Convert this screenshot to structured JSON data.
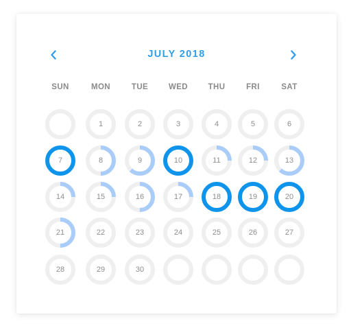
{
  "calendar": {
    "month_title": "JULY 2018",
    "prev_icon": "chevron-left-icon",
    "next_icon": "chevron-right-icon",
    "weekdays": [
      "SUN",
      "MON",
      "TUE",
      "WED",
      "THU",
      "FRI",
      "SAT"
    ],
    "colors": {
      "accent": "#2f9fe6",
      "ring_full": "#0f94ec",
      "ring_partial": "#a9cdf8",
      "ring_track": "#efefef",
      "day_text": "#8d8d8d"
    },
    "weeks": [
      [
        {
          "day": "",
          "fill": 0
        },
        {
          "day": "1",
          "fill": 0
        },
        {
          "day": "2",
          "fill": 0
        },
        {
          "day": "3",
          "fill": 0
        },
        {
          "day": "4",
          "fill": 0
        },
        {
          "day": "5",
          "fill": 0
        },
        {
          "day": "6",
          "fill": 0
        }
      ],
      [
        {
          "day": "7",
          "fill": 1
        },
        {
          "day": "8",
          "fill": 0.5
        },
        {
          "day": "9",
          "fill": 0.62
        },
        {
          "day": "10",
          "fill": 1
        },
        {
          "day": "11",
          "fill": 0.25
        },
        {
          "day": "12",
          "fill": 0.25
        },
        {
          "day": "13",
          "fill": 0.62
        }
      ],
      [
        {
          "day": "14",
          "fill": 0.25
        },
        {
          "day": "15",
          "fill": 0.25
        },
        {
          "day": "16",
          "fill": 0.5
        },
        {
          "day": "17",
          "fill": 0.25
        },
        {
          "day": "18",
          "fill": 1
        },
        {
          "day": "19",
          "fill": 1
        },
        {
          "day": "20",
          "fill": 1
        }
      ],
      [
        {
          "day": "21",
          "fill": 0.5
        },
        {
          "day": "22",
          "fill": 0
        },
        {
          "day": "23",
          "fill": 0
        },
        {
          "day": "24",
          "fill": 0
        },
        {
          "day": "25",
          "fill": 0
        },
        {
          "day": "26",
          "fill": 0
        },
        {
          "day": "27",
          "fill": 0
        }
      ],
      [
        {
          "day": "28",
          "fill": 0
        },
        {
          "day": "29",
          "fill": 0
        },
        {
          "day": "30",
          "fill": 0
        },
        {
          "day": "",
          "fill": 0
        },
        {
          "day": "",
          "fill": 0
        },
        {
          "day": "",
          "fill": 0
        },
        {
          "day": "",
          "fill": 0
        }
      ]
    ]
  }
}
